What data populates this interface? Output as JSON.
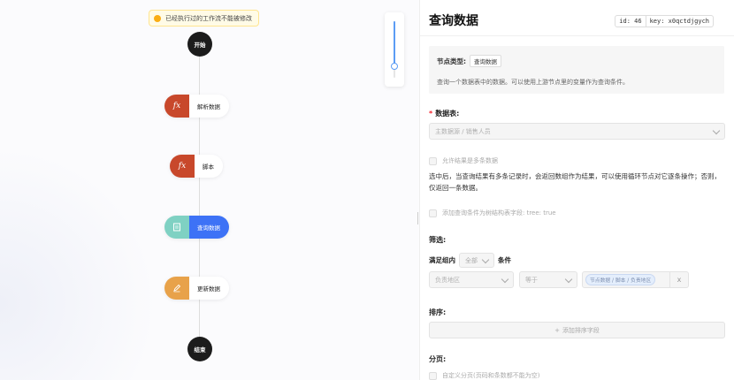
{
  "canvas": {
    "warning": "已经执行过的工作流不能被修改",
    "start_node": "开始",
    "end_node": "结束",
    "nodes": [
      {
        "label": "解析数据",
        "icon": "fx",
        "color": "#c8482b"
      },
      {
        "label": "脚本",
        "icon": "fx",
        "color": "#c8482b"
      },
      {
        "label": "查询数据",
        "icon": "table-icon",
        "color": "#7fd1c3"
      },
      {
        "label": "更新数据",
        "icon": "edit-icon",
        "color": "#e8a24a"
      }
    ],
    "zoom_level": 0.8
  },
  "panel": {
    "title": "查询数据",
    "id_text": "id: 46",
    "key_text": "key: x0qctdjgych",
    "node_type_label": "节点类型:",
    "node_type_value": "查询数据",
    "description": "查询一个数据表中的数据。可以使用上游节点里的变量作为查询条件。",
    "table_label": "数据表:",
    "table_value": "主数据源 / 销售人员",
    "allow_multiple": "允许结果是多条数据",
    "help_text": "选中后，当查询结果有多条记录时，会返回数组作为结果，可以使用循环节点对它逐条操作；否则，仅返回一条数据。",
    "tree_checkbox": "添加查询条件为树结构表字段: tree: true",
    "filter_label": "筛选:",
    "cond_prefix": "满足组内",
    "cond_mode": "全部",
    "cond_suffix": "条件",
    "filter_field": "负责地区",
    "filter_op": "等于",
    "filter_var": "节点数据 / 脚本 / 负责地区",
    "filter_remove": "x",
    "sort_label": "排序:",
    "add_sort": "添加排序字段",
    "paging_label": "分页:",
    "paging_checkbox": "自定义分页(页码和条数都不能为空)"
  }
}
